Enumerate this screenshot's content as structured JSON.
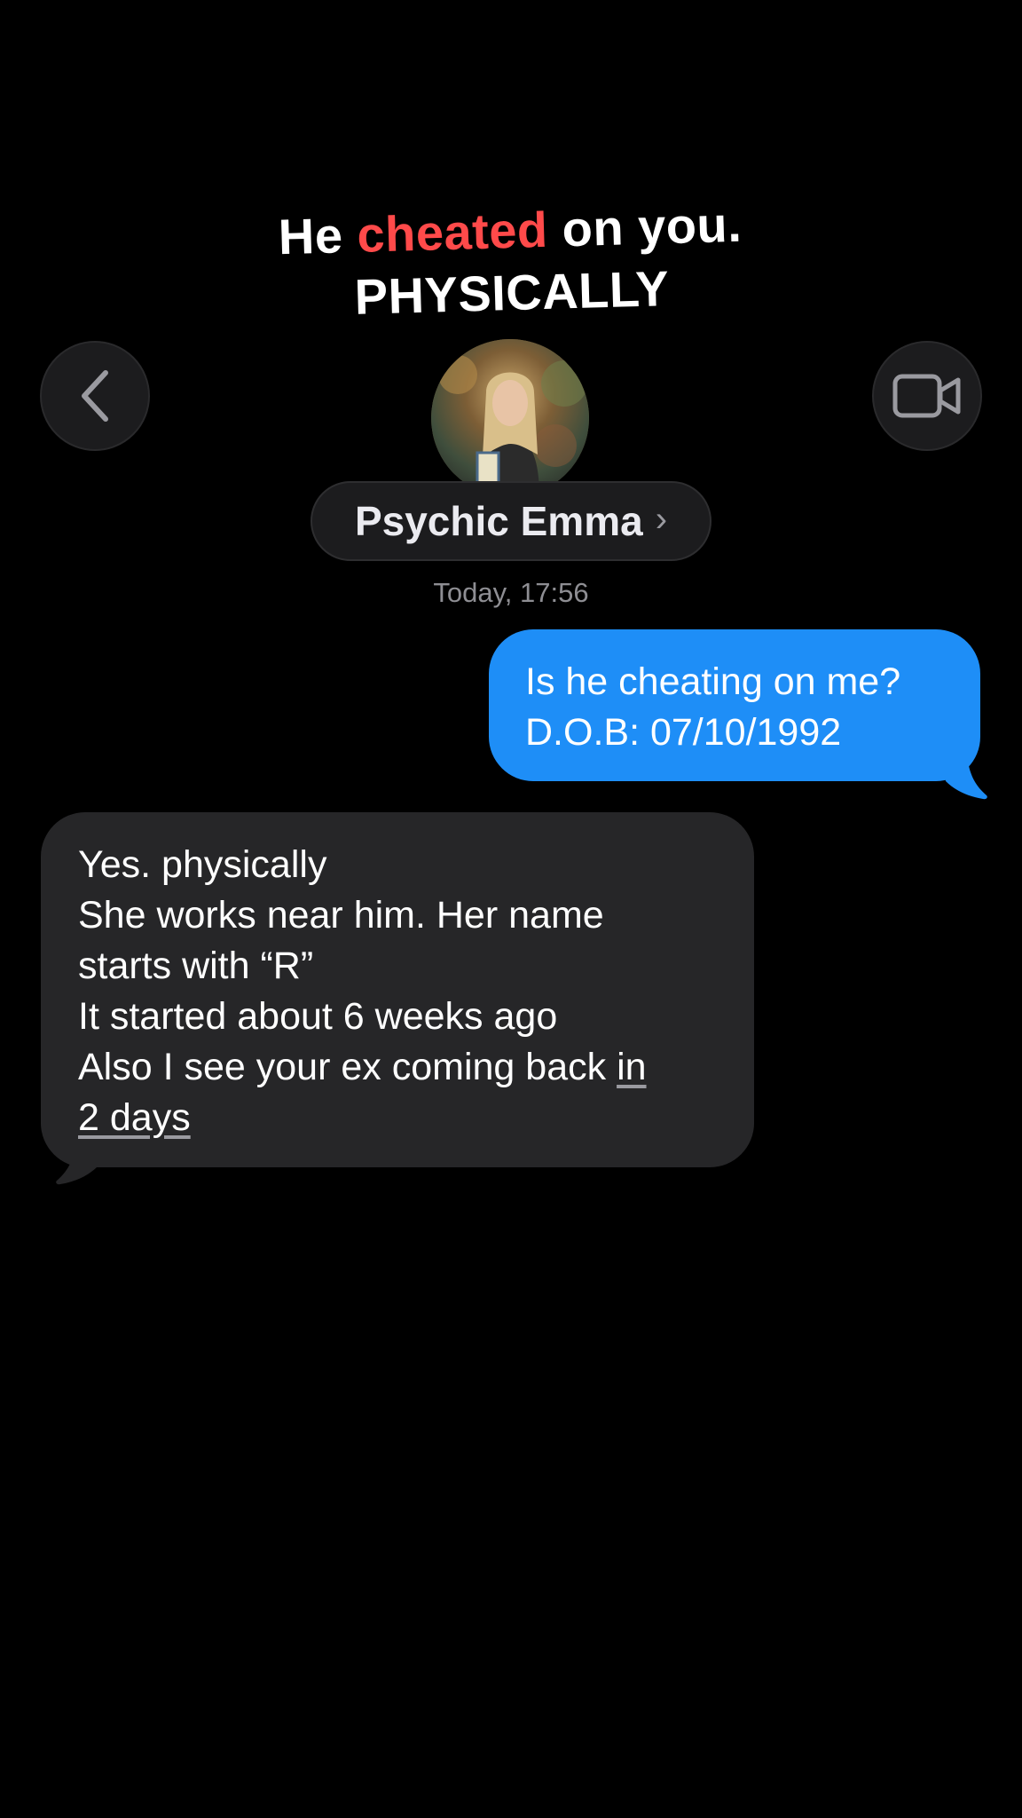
{
  "caption": {
    "line1_prefix": "He ",
    "line1_accent": "cheated",
    "line1_suffix": " on you.",
    "line2": "PHYSICALLY",
    "accent_color": "#ff4a4a"
  },
  "header": {
    "back_icon": "chevron-left-icon",
    "video_icon": "video-camera-icon",
    "contact_name": "Psychic Emma",
    "contact_chevron": "›"
  },
  "conversation": {
    "timestamp": "Today, 17:56",
    "messages": [
      {
        "direction": "outgoing",
        "color": "#1e8ef7",
        "lines": [
          "Is he cheating on me?",
          "D.O.B: 07/10/1992"
        ]
      },
      {
        "direction": "incoming",
        "color": "#262628",
        "lines": [
          "Yes. physically",
          "She works near him. Her name",
          "starts with “R”",
          "It started about 6 weeks ago",
          "Also I see your ex coming back "
        ],
        "link_part1": "in",
        "link_part2": "2 days"
      }
    ]
  }
}
